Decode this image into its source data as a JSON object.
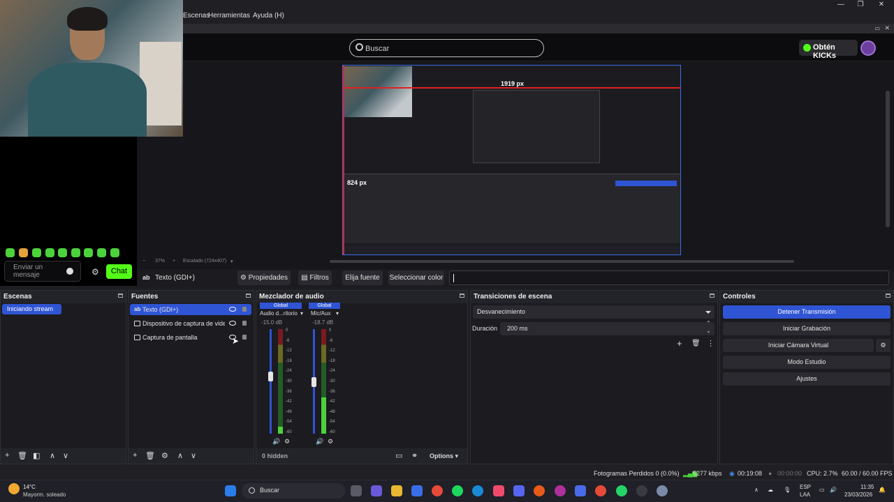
{
  "menubar": {
    "items": [
      "Escenas",
      "Herramientas",
      "Ayuda (H)"
    ],
    "window_controls": [
      "minimize-icon",
      "maximize-icon",
      "close-icon"
    ]
  },
  "kick": {
    "search_placeholder": "Buscar",
    "kicks_button": "Obtén KICKs",
    "chat_placeholder": "Enviar un mensaje",
    "chat_button": "Chat",
    "accent_color": "#53fc18"
  },
  "preview": {
    "nested_width_label": "1919 px",
    "nested_height_label": "824 px",
    "zoom": "37%",
    "scale_info": "Escalado (724x407)"
  },
  "source_toolbar": {
    "selected_source": "Texto (GDI+)",
    "properties": "Propiedades",
    "filters": "Filtros",
    "choose_font": "Elija fuente",
    "choose_color": "Seleccionar color"
  },
  "scenes": {
    "title": "Escenas",
    "items": [
      "Iniciando stream"
    ]
  },
  "sources": {
    "title": "Fuentes",
    "items": [
      "Texto (GDI+)",
      "Dispositivo de captura de vide",
      "Captura de pantalla"
    ]
  },
  "mixer": {
    "title": "Mezclador de audio",
    "channels": [
      {
        "badge": "Global",
        "name": "Audio d...ritorio",
        "db": "-15.0 dB"
      },
      {
        "badge": "Global",
        "name": "Mic/Aux",
        "db": "-18.7 dB"
      }
    ],
    "scale": [
      "0",
      "-6",
      "-12",
      "-18",
      "-24",
      "-30",
      "-36",
      "-42",
      "-48",
      "-54",
      "-60"
    ],
    "hidden": "0 hidden",
    "options": "Options"
  },
  "transitions": {
    "title": "Transiciones de escena",
    "selected": "Desvanecimiento",
    "duration_label": "Duración",
    "duration_value": "200 ms"
  },
  "controls": {
    "title": "Controles",
    "stop_stream": "Detener Transmisión",
    "start_recording": "Iniciar Grabación",
    "virtual_cam": "Iniciar Cámara Virtual",
    "studio_mode": "Modo Estudio",
    "settings": "Ajustes",
    "primary_color": "#2f55d4"
  },
  "status": {
    "dropped": "Fotogramas Perdidos 0 (0.0%)",
    "bitrate": "5277 kbps",
    "stream_time": "00:19:08",
    "rec_time": "00:00:00",
    "cpu": "CPU: 2.7%",
    "fps": "60.00 / 60.00 FPS"
  },
  "taskbar": {
    "weather_temp": "14°C",
    "weather_desc": "Mayorm. soleado",
    "search": "Buscar",
    "lang_1": "ESP",
    "lang_2": "LAA",
    "time": "11:35",
    "date": "23/03/2026"
  }
}
